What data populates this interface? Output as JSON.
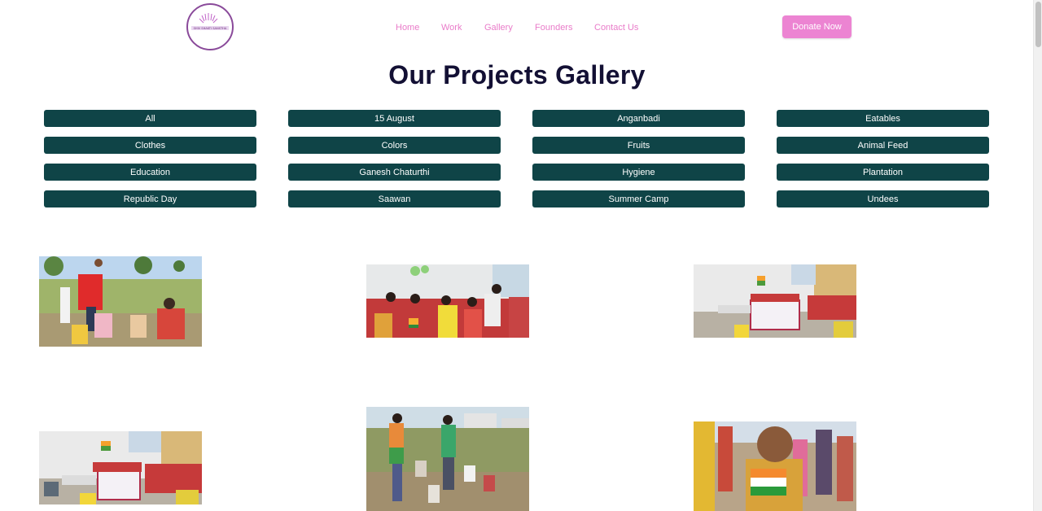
{
  "header": {
    "logo_text": "SHIV SHAKTI SANSTHA",
    "nav": [
      "Home",
      "Work",
      "Gallery",
      "Founders",
      "Contact Us"
    ],
    "donate_label": "Donate Now"
  },
  "main": {
    "title": "Our Projects Gallery",
    "filters": [
      "All",
      "15 August",
      "Anganbadi",
      "Eatables",
      "Clothes",
      "Colors",
      "Fruits",
      "Animal Feed",
      "Education",
      "Ganesh Chaturthi",
      "Hygiene",
      "Plantation",
      "Republic Day",
      "Saawan",
      "Summer Camp",
      "Undees"
    ]
  },
  "gallery": {
    "photos": [
      "photo-children-field-1",
      "photo-children-flags-indoor",
      "photo-children-queue-banner",
      "photo-children-queue-banner-2",
      "photo-children-field-2",
      "photo-child-flag"
    ]
  },
  "colors": {
    "accent": "#ec84d2",
    "nav_link": "#e97cc9",
    "filter_bg": "#0f4447",
    "title": "#131034"
  }
}
